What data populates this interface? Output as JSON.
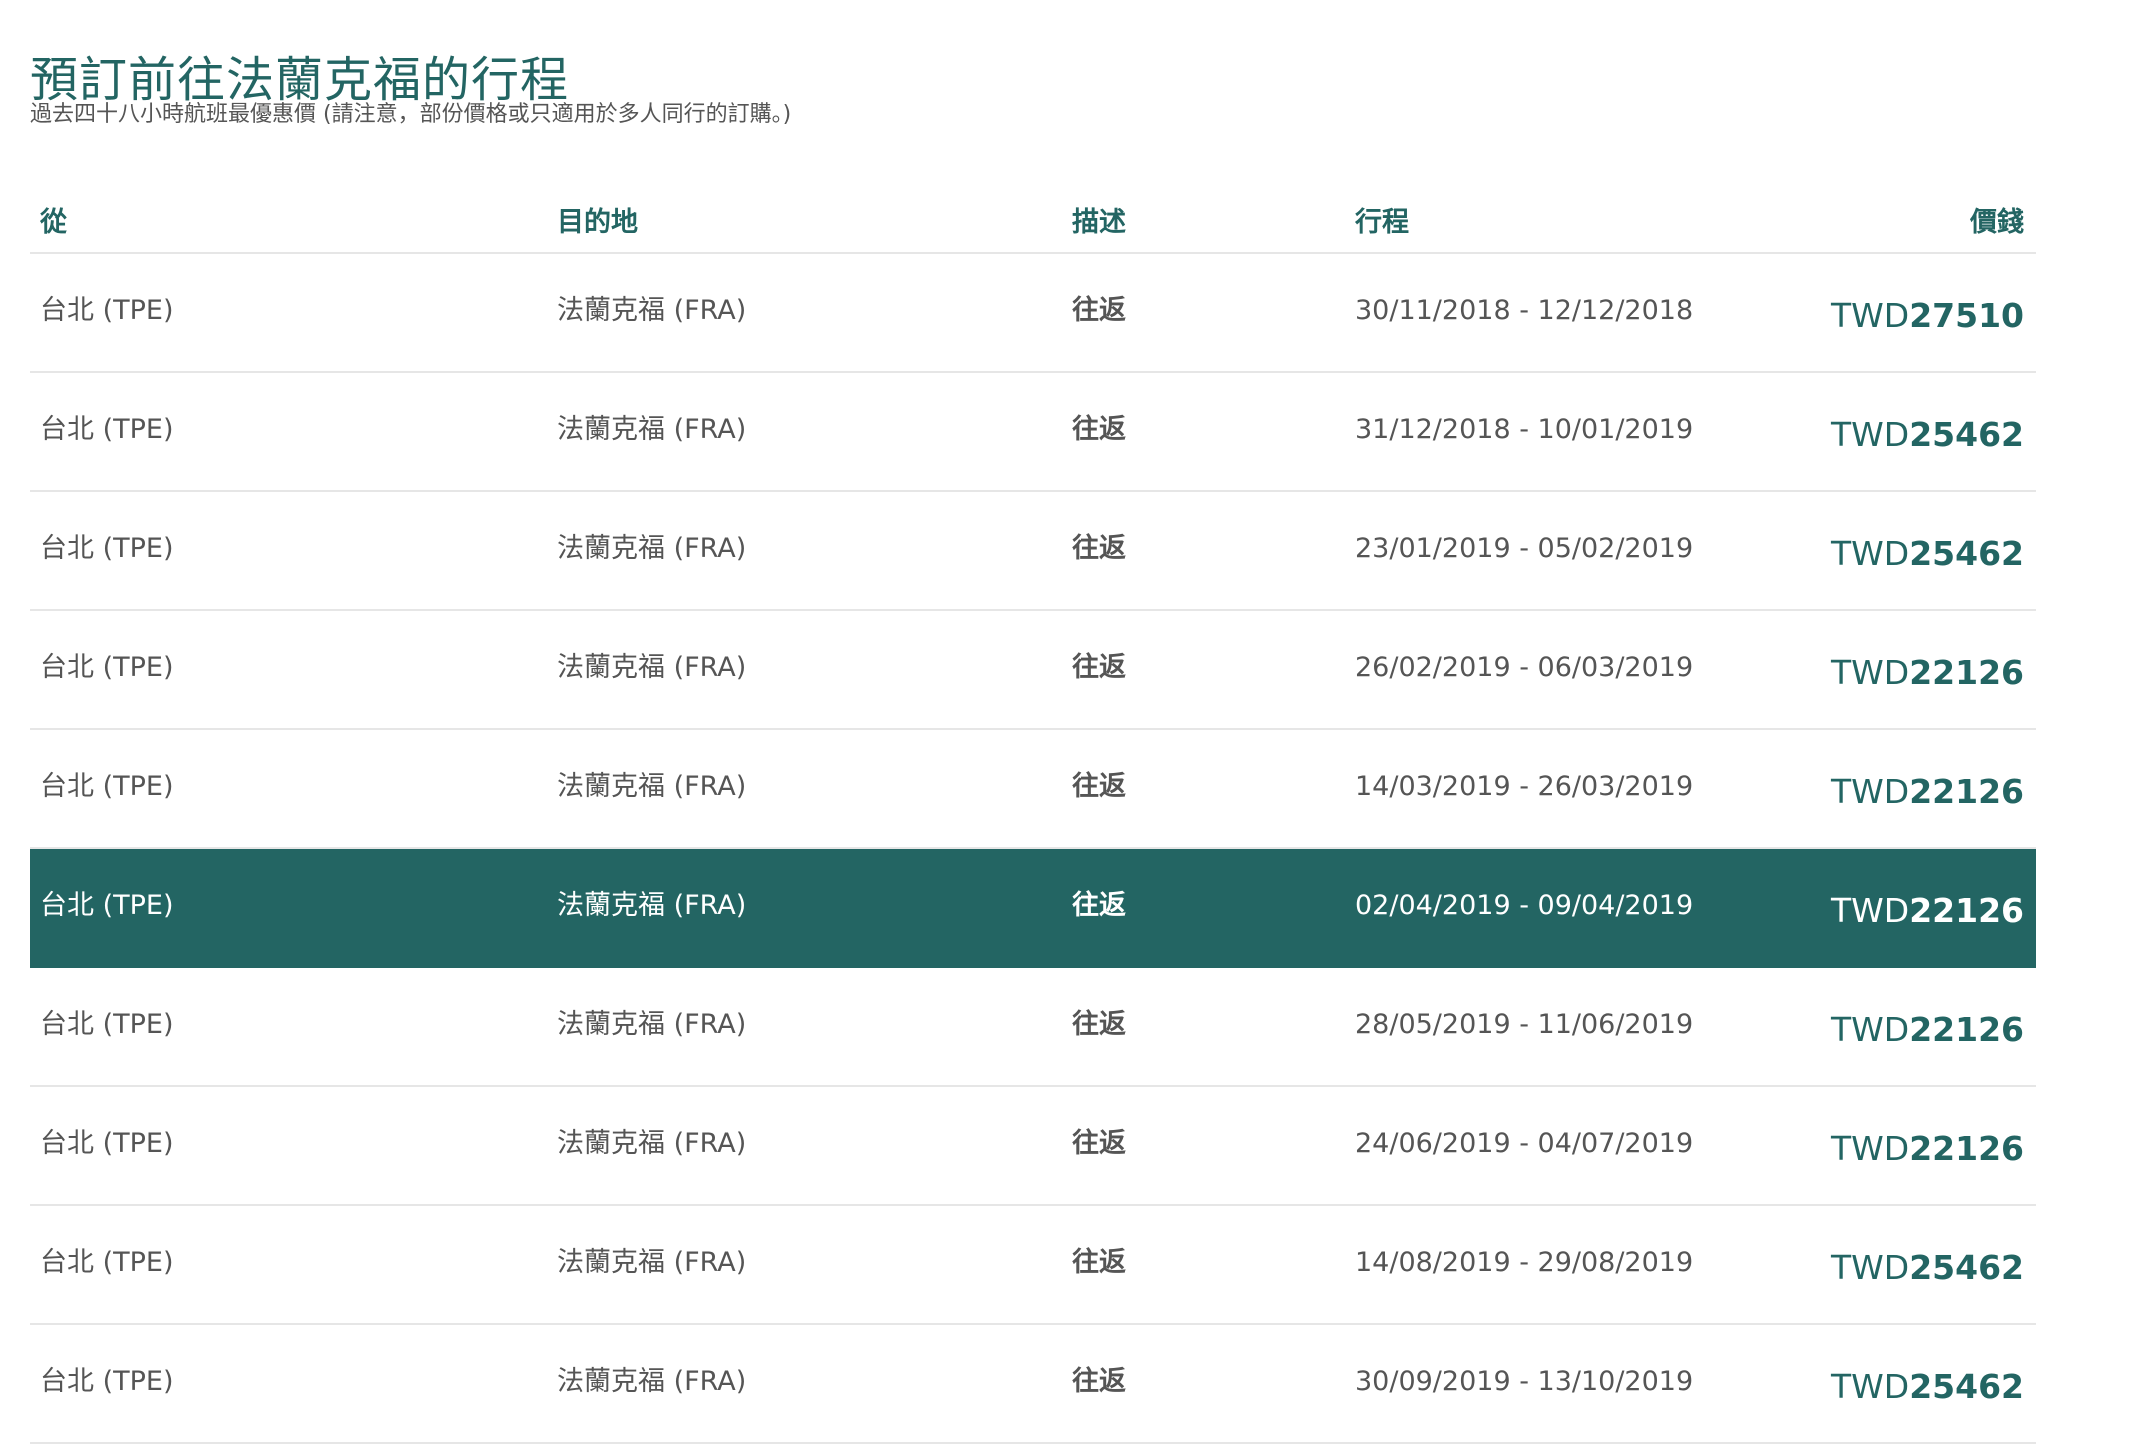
{
  "page": {
    "title": "預訂前往法蘭克福的行程",
    "subtitle": "過去四十八小時航班最優惠價 (請注意，部份價格或只適用於多人同行的訂購。)"
  },
  "colors": {
    "accent": "#236563",
    "text": "#555555",
    "divider": "#e6e6e6",
    "highlight_text": "#ffffff"
  },
  "table": {
    "headers": {
      "from": "從",
      "to": "目的地",
      "description": "描述",
      "itinerary": "行程",
      "price": "價錢"
    },
    "highlighted_row_index": 5,
    "rows": [
      {
        "from": "台北 (TPE)",
        "to": "法蘭克福 (FRA)",
        "description": "往返",
        "itinerary": "30/11/2018 - 12/12/2018",
        "currency": "TWD",
        "amount": "27510"
      },
      {
        "from": "台北 (TPE)",
        "to": "法蘭克福 (FRA)",
        "description": "往返",
        "itinerary": "31/12/2018 - 10/01/2019",
        "currency": "TWD",
        "amount": "25462"
      },
      {
        "from": "台北 (TPE)",
        "to": "法蘭克福 (FRA)",
        "description": "往返",
        "itinerary": "23/01/2019 - 05/02/2019",
        "currency": "TWD",
        "amount": "25462"
      },
      {
        "from": "台北 (TPE)",
        "to": "法蘭克福 (FRA)",
        "description": "往返",
        "itinerary": "26/02/2019 - 06/03/2019",
        "currency": "TWD",
        "amount": "22126"
      },
      {
        "from": "台北 (TPE)",
        "to": "法蘭克福 (FRA)",
        "description": "往返",
        "itinerary": "14/03/2019 - 26/03/2019",
        "currency": "TWD",
        "amount": "22126"
      },
      {
        "from": "台北 (TPE)",
        "to": "法蘭克福 (FRA)",
        "description": "往返",
        "itinerary": "02/04/2019 - 09/04/2019",
        "currency": "TWD",
        "amount": "22126"
      },
      {
        "from": "台北 (TPE)",
        "to": "法蘭克福 (FRA)",
        "description": "往返",
        "itinerary": "28/05/2019 - 11/06/2019",
        "currency": "TWD",
        "amount": "22126"
      },
      {
        "from": "台北 (TPE)",
        "to": "法蘭克福 (FRA)",
        "description": "往返",
        "itinerary": "24/06/2019 - 04/07/2019",
        "currency": "TWD",
        "amount": "22126"
      },
      {
        "from": "台北 (TPE)",
        "to": "法蘭克福 (FRA)",
        "description": "往返",
        "itinerary": "14/08/2019 - 29/08/2019",
        "currency": "TWD",
        "amount": "25462"
      },
      {
        "from": "台北 (TPE)",
        "to": "法蘭克福 (FRA)",
        "description": "往返",
        "itinerary": "30/09/2019 - 13/10/2019",
        "currency": "TWD",
        "amount": "25462"
      }
    ]
  }
}
